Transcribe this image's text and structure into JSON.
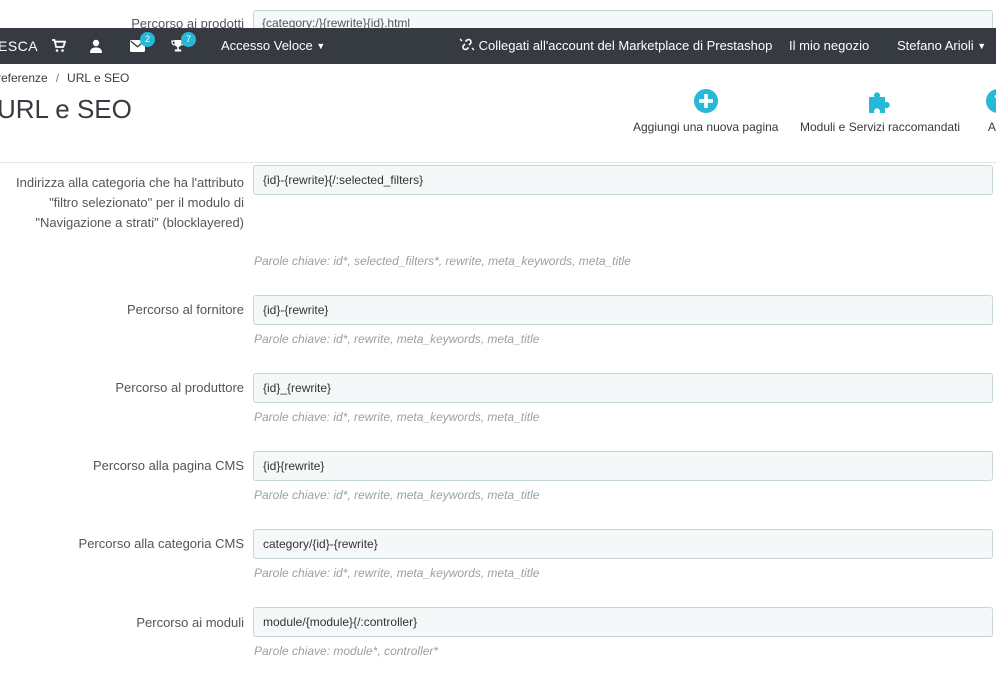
{
  "scrolled_row": {
    "label": "Percorso ai prodotti",
    "value": "{category:/}{rewrite}{id}.html"
  },
  "topbar": {
    "brand": "ESCA",
    "orders_badge": "",
    "messages_badge": "2",
    "trophy_badge": "7",
    "quick_access": "Accesso Veloce",
    "marketplace": "Collegati all'account del Marketplace di Prestashop",
    "my_shop": "Il mio negozio",
    "user": "Stefano Arioli"
  },
  "breadcrumb": {
    "parent": "referenze",
    "separator": "/",
    "current": "URL e SEO"
  },
  "page_title": "URL e SEO",
  "toolbar": {
    "add_page": "Aggiungi una nuova pagina",
    "modules": "Moduli e Servizi raccomandati",
    "help": "Aiu"
  },
  "colors": {
    "accent": "#25b9d7",
    "header_bg": "#363a41"
  },
  "rows": [
    {
      "label": "Indirizza alla categoria che ha l'attributo \"filtro selezionato\" per il modulo di \"Navigazione a strati\" (blocklayered)",
      "value": "{id}-{rewrite}{/:selected_filters}",
      "help": "Parole chiave: id*, selected_filters*, rewrite, meta_keywords, meta_title"
    },
    {
      "label": "Percorso al fornitore",
      "value": "{id}-{rewrite}",
      "help": "Parole chiave: id*, rewrite, meta_keywords, meta_title"
    },
    {
      "label": "Percorso al produttore",
      "value": "{id}_{rewrite}",
      "help": "Parole chiave: id*, rewrite, meta_keywords, meta_title"
    },
    {
      "label": "Percorso alla pagina CMS",
      "value": "{id}{rewrite}",
      "help": "Parole chiave: id*, rewrite, meta_keywords, meta_title"
    },
    {
      "label": "Percorso alla categoria CMS",
      "value": "category/{id}-{rewrite}",
      "help": "Parole chiave: id*, rewrite, meta_keywords, meta_title"
    },
    {
      "label": "Percorso ai moduli",
      "value": "module/{module}{/:controller}",
      "help": "Parole chiave: module*, controller*"
    }
  ]
}
